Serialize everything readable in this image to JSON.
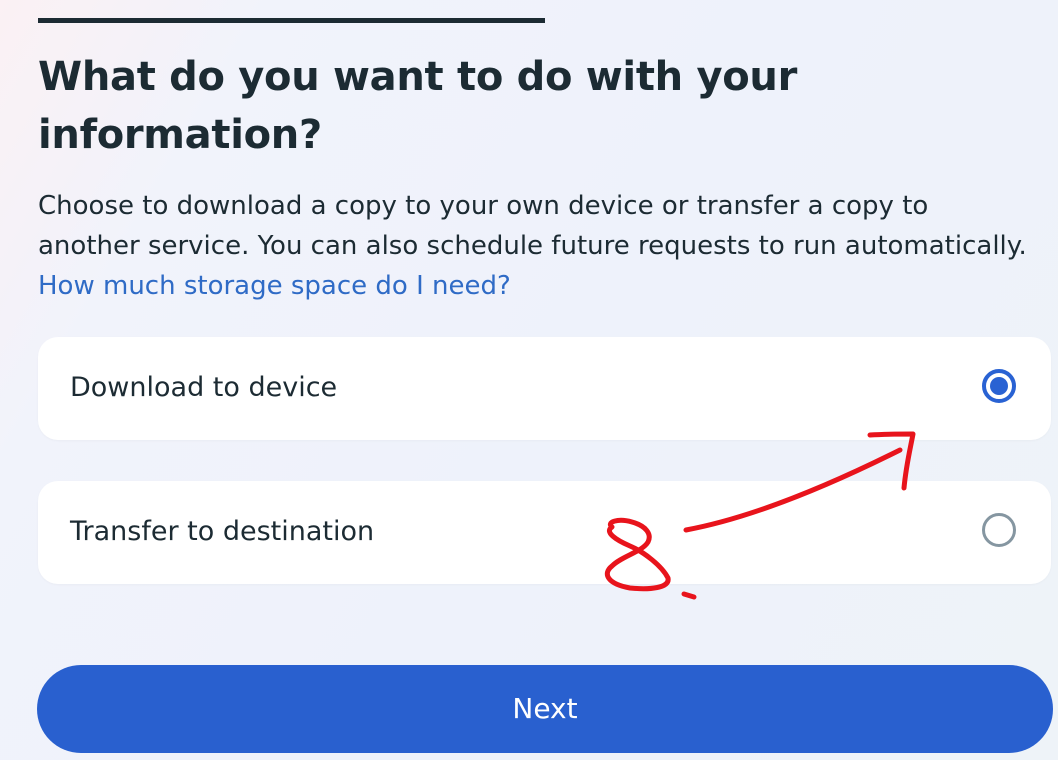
{
  "page": {
    "title": "What do you want to do with your information?",
    "description_text": "Choose to download a copy to your own device or transfer a copy to another service. You can also schedule future requests to run automatically.",
    "help_link": "How much storage space do I need?"
  },
  "options": [
    {
      "label": "Download to device",
      "selected": true
    },
    {
      "label": "Transfer to destination",
      "selected": false
    }
  ],
  "next_button": {
    "label": "Next"
  },
  "colors": {
    "accent": "#2962d3",
    "link": "#2f6bc6",
    "text": "#1c2b33",
    "annotation": "#e8141c"
  }
}
